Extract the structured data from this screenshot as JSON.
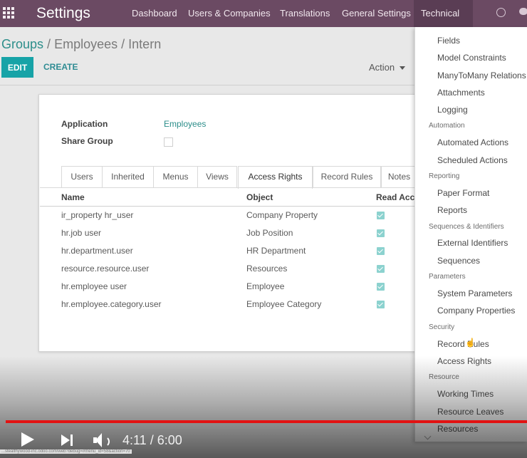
{
  "topbar": {
    "brand": "Settings",
    "menu": [
      "Dashboard",
      "Users & Companies",
      "Translations",
      "General Settings",
      "Technical"
    ]
  },
  "breadcrumb": {
    "link": "Groups",
    "sep1": "/",
    "mid": "Employees",
    "sep2": "/",
    "current": "Intern"
  },
  "toolbar": {
    "edit": "EDIT",
    "create": "CREATE",
    "action": "Action"
  },
  "form": {
    "application_label": "Application",
    "application_value": "Employees",
    "share_label": "Share Group",
    "share_checked": false
  },
  "tabs": [
    "Users",
    "Inherited",
    "Menus",
    "Views",
    "Access Rights",
    "Record Rules",
    "Notes"
  ],
  "active_tab": "Access Rights",
  "table": {
    "headers": [
      "Name",
      "Object",
      "Read Acc"
    ],
    "rows": [
      {
        "name": "ir_property hr_user",
        "object": "Company Property",
        "read": true
      },
      {
        "name": "hr.job user",
        "object": "Job Position",
        "read": true
      },
      {
        "name": "hr.department.user",
        "object": "HR Department",
        "read": true
      },
      {
        "name": "resource.resource.user",
        "object": "Resources",
        "read": true
      },
      {
        "name": "hr.employee user",
        "object": "Employee",
        "read": true
      },
      {
        "name": "hr.employee.category.user",
        "object": "Employee Category",
        "read": true
      }
    ]
  },
  "dropdown": [
    {
      "type": "item",
      "text": "Fields"
    },
    {
      "type": "item",
      "text": "Model Constraints"
    },
    {
      "type": "item",
      "text": "ManyToMany Relations"
    },
    {
      "type": "item",
      "text": "Attachments"
    },
    {
      "type": "item",
      "text": "Logging"
    },
    {
      "type": "header",
      "text": "Automation"
    },
    {
      "type": "item",
      "text": "Automated Actions"
    },
    {
      "type": "item",
      "text": "Scheduled Actions"
    },
    {
      "type": "header",
      "text": "Reporting"
    },
    {
      "type": "item",
      "text": "Paper Format"
    },
    {
      "type": "item",
      "text": "Reports"
    },
    {
      "type": "header",
      "text": "Sequences & Identifiers"
    },
    {
      "type": "item",
      "text": "External Identifiers"
    },
    {
      "type": "item",
      "text": "Sequences"
    },
    {
      "type": "header",
      "text": "Parameters"
    },
    {
      "type": "item",
      "text": "System Parameters"
    },
    {
      "type": "item",
      "text": "Company Properties"
    },
    {
      "type": "header",
      "text": "Security"
    },
    {
      "type": "item",
      "text": "Record Rules"
    },
    {
      "type": "item",
      "text": "Access Rights"
    },
    {
      "type": "header",
      "text": "Resource"
    },
    {
      "type": "item",
      "text": "Working Times"
    },
    {
      "type": "item",
      "text": "Resource Leaves"
    },
    {
      "type": "item",
      "text": "Resources"
    }
  ],
  "player": {
    "time": "4:11 / 6:00",
    "progress": 0.7,
    "url": "...stealthywood-inc.odoo.com/web?debug=#menu_id=58&action=70"
  },
  "colors": {
    "topbar": "#6b4a63",
    "accent": "#17a3a7",
    "link": "#2c8e8a",
    "progress": "#e21212"
  },
  "icons": [
    "apps-grid-icon",
    "clock-icon",
    "chat-icon",
    "caret-down-icon",
    "play-icon",
    "next-icon",
    "volume-icon",
    "chevron-down-icon",
    "cursor-icon"
  ]
}
